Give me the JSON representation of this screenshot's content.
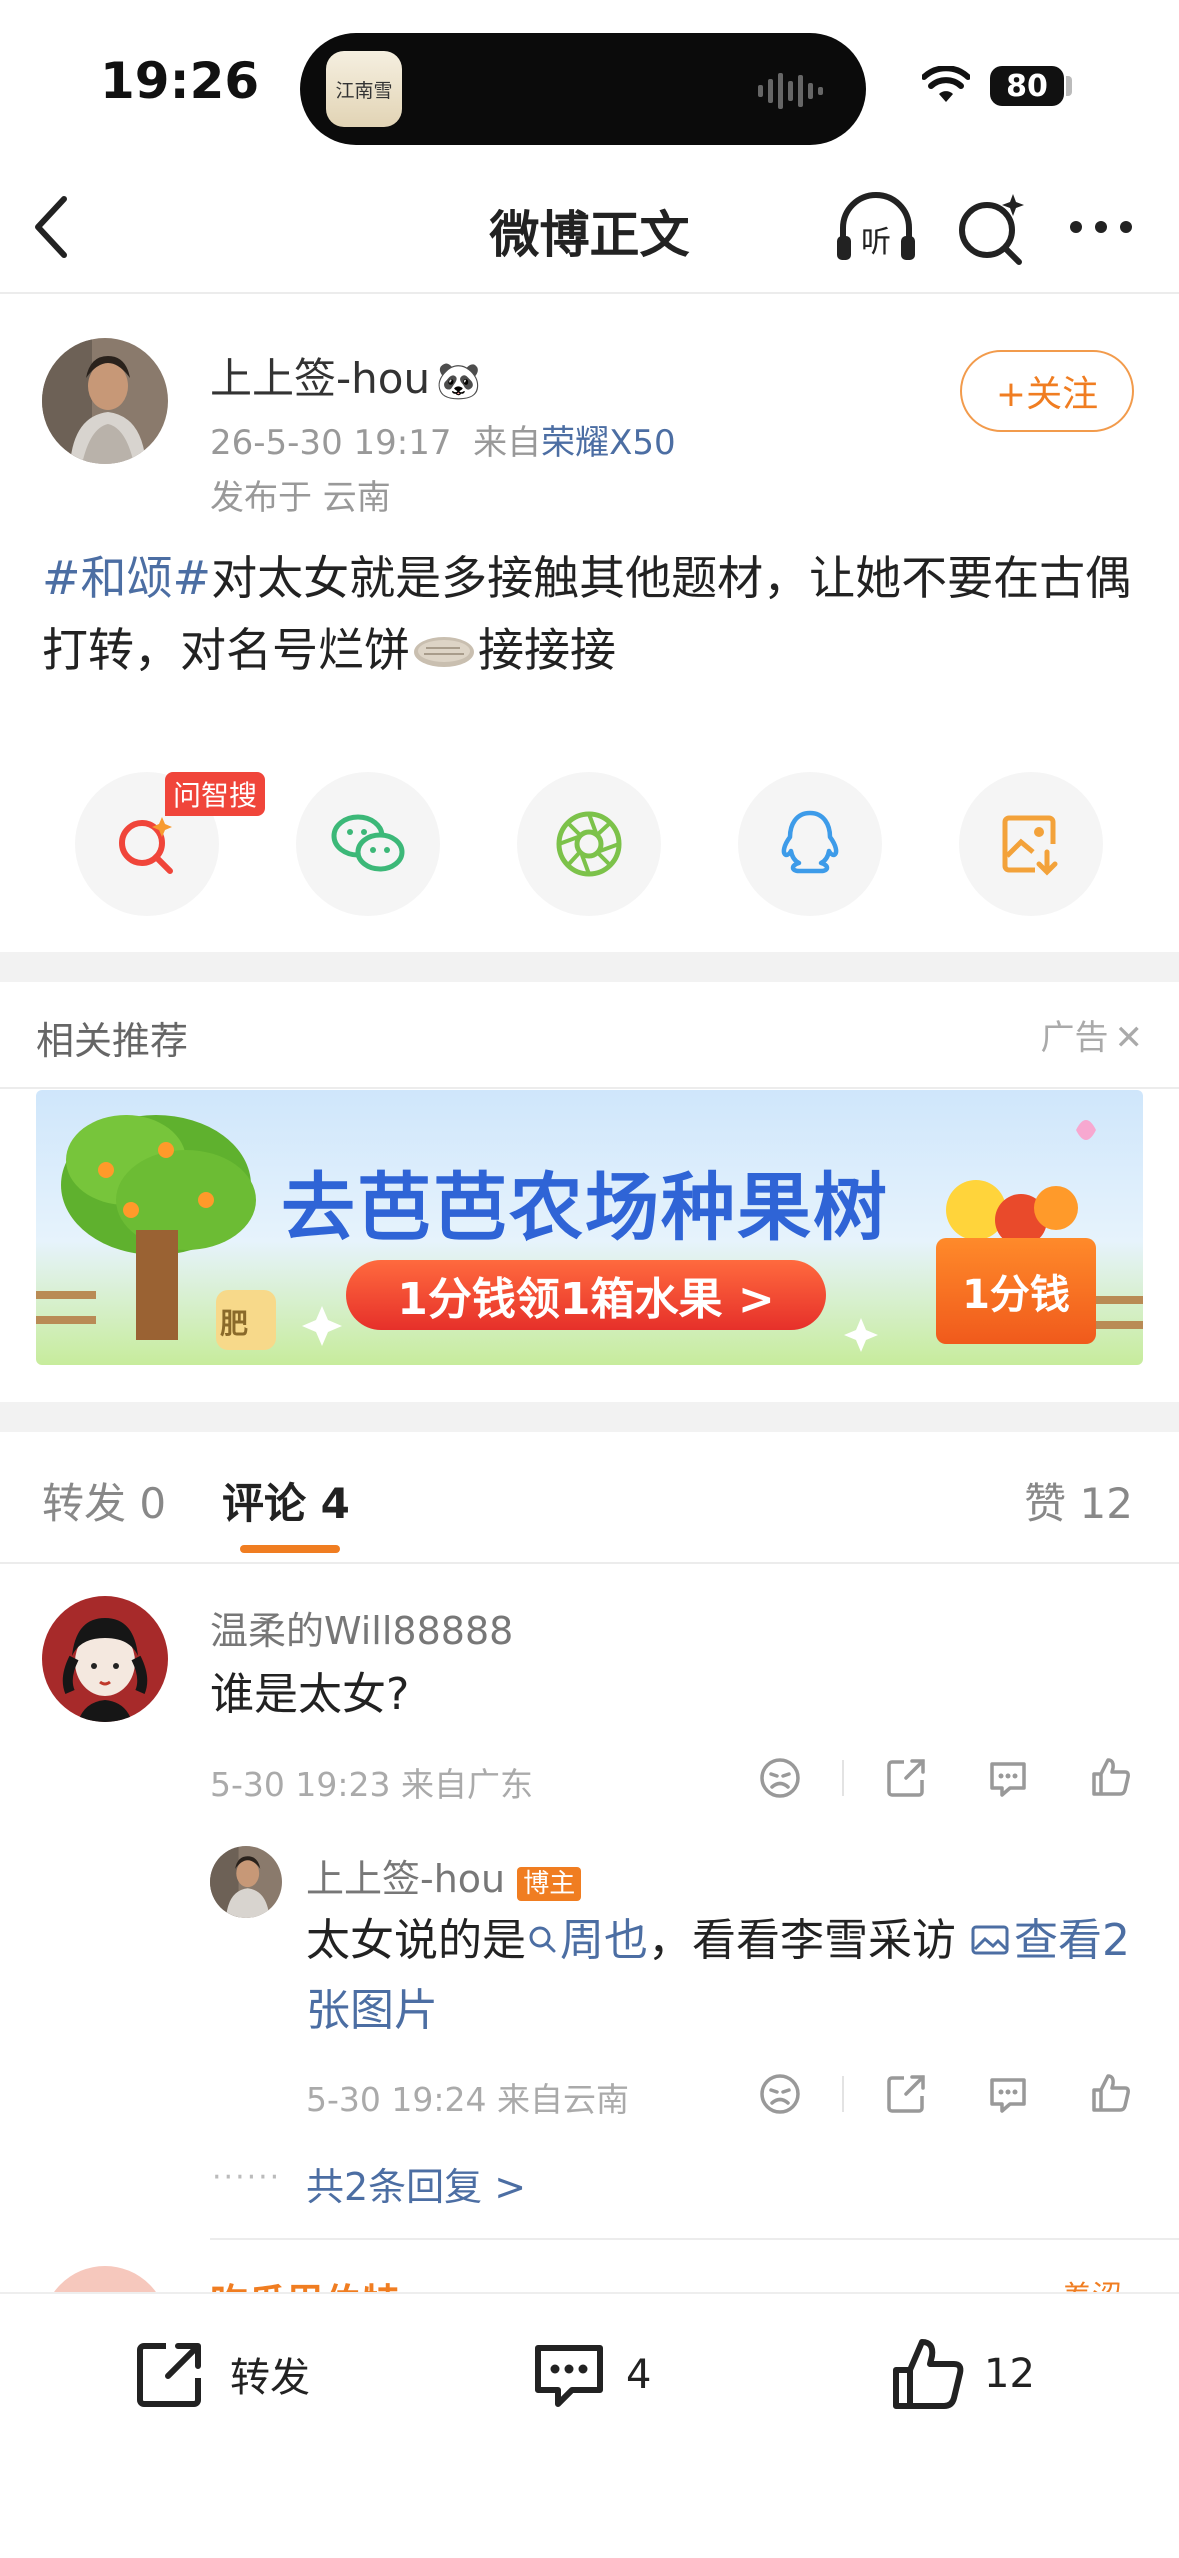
{
  "status_bar": {
    "time": "19:26",
    "battery": "80",
    "island_app_text": "江南雪"
  },
  "nav": {
    "title": "微博正文"
  },
  "post": {
    "author": "上上签-hou",
    "author_emoji": "🐼",
    "time": "26-5-30 19:17",
    "from_prefix": "来自",
    "device": "荣耀X50",
    "location": "发布于 云南",
    "follow_label": "+关注",
    "hashtag": "#和颂#",
    "text_main": "对太女就是多接触其他题材，让她不要在古偶打转，对名号烂饼",
    "text_end": "接接接"
  },
  "share": {
    "badge": "问智搜"
  },
  "recommend": {
    "title": "相关推荐",
    "ad_label": "广告"
  },
  "banner": {
    "title": "去芭芭农场种果树",
    "button": "1分钱领1箱水果 >",
    "box": "1分钱",
    "tree_tag": "肥"
  },
  "tabs": {
    "repost": "转发",
    "repost_count": "0",
    "comment": "评论",
    "comment_count": "4",
    "like": "赞",
    "like_count": "12"
  },
  "comments": [
    {
      "name": "温柔的Will88888",
      "text": "谁是太女?",
      "meta": "5-30 19:23 来自广东",
      "reply": {
        "name": "上上签-hou",
        "badge": "博主",
        "text_a": "太女说的是",
        "mention": "周也",
        "text_b": "，看看李雪采访 ",
        "link": "查看2张图片",
        "meta": "5-30 19:24 来自云南"
      },
      "more_replies": "共2条回复 >"
    },
    {
      "name": "吃瓜里伯特",
      "tag": "羞涩"
    }
  ],
  "bottom_bar": {
    "repost": "转发",
    "comments": "4",
    "likes": "12"
  }
}
